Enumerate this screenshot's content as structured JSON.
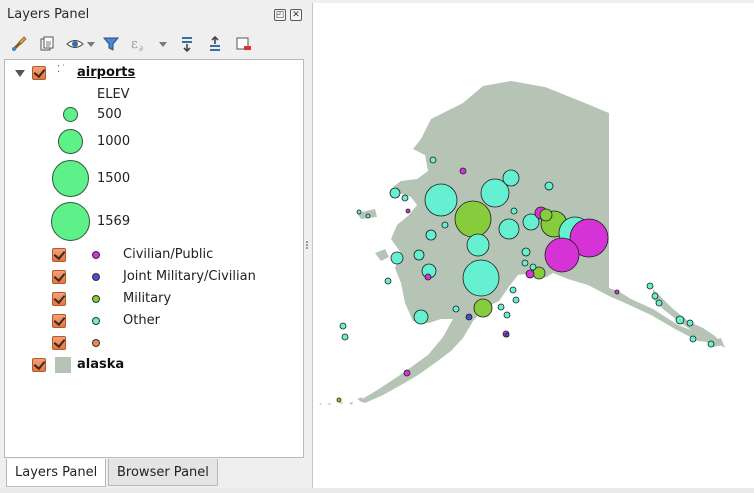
{
  "dock": {
    "title": "Layers Panel",
    "float_glyph": "◰",
    "close_glyph": "✕"
  },
  "toolbar": {
    "icons": [
      "style-manager-icon",
      "add-group-icon",
      "visibility-icon",
      "filter-legend-icon",
      "filter-expression-icon",
      "expand-all-icon",
      "collapse-all-icon",
      "remove-layer-icon"
    ]
  },
  "layers": {
    "airports": {
      "name": "airports",
      "size_field": "ELEV",
      "sizes": [
        {
          "label": "500",
          "value": 500
        },
        {
          "label": "1000",
          "value": 1000
        },
        {
          "label": "1500",
          "value": 1500
        },
        {
          "label": "1569",
          "value": 1569
        }
      ],
      "categories": [
        {
          "label": "Civilian/Public",
          "color": "#d633d6"
        },
        {
          "label": "Joint Military/Civilian",
          "color": "#4a50c8"
        },
        {
          "label": "Military",
          "color": "#86cc3c"
        },
        {
          "label": "Other",
          "color": "#66f0d2"
        },
        {
          "label": "",
          "color": "#f0884a"
        }
      ],
      "size_color": "#5ef18a"
    },
    "alaska": {
      "name": "alaska",
      "color": "#b6c4b5"
    }
  },
  "tabs": [
    {
      "label": "Layers Panel",
      "active": true
    },
    {
      "label": "Browser Panel",
      "active": false
    }
  ],
  "map": {
    "land_color": "#b6c4b5"
  }
}
